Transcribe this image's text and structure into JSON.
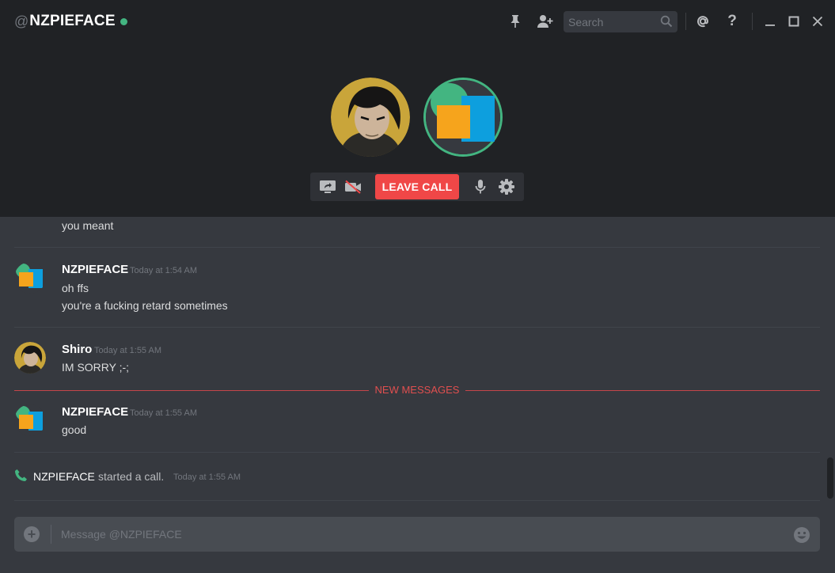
{
  "header": {
    "at_symbol": "@",
    "channel_name": "NZPIEFACE",
    "status_color": "#43b581",
    "icons": [
      "pin-icon",
      "add-friend-icon",
      "search-icon",
      "mention-icon",
      "help-icon",
      "minimize-icon",
      "maximize-icon",
      "close-icon"
    ],
    "search_placeholder": "Search",
    "help_label": "?"
  },
  "call": {
    "leave_label": "LEAVE CALL",
    "leave_color": "#f04747",
    "speaking_color": "#43b581",
    "icons": [
      "screen-share-icon",
      "video-off-icon",
      "microphone-icon",
      "settings-icon"
    ]
  },
  "messages": {
    "partial_line": "you meant",
    "groups": [
      {
        "author": "NZPIEFACE",
        "timestamp": "Today at 1:54 AM",
        "lines": [
          "oh ffs",
          "you're a fucking retard sometimes"
        ]
      },
      {
        "author": "Shiro",
        "timestamp": "Today at 1:55 AM",
        "lines": [
          "IM SORRY ;-;"
        ]
      },
      {
        "author": "NZPIEFACE",
        "timestamp": "Today at 1:55 AM",
        "lines": [
          "good"
        ]
      }
    ],
    "new_messages_label": "NEW MESSAGES",
    "new_messages_color": "#f04747",
    "system_call": {
      "user": "NZPIEFACE",
      "text": "started a call.",
      "timestamp": "Today at 1:55 AM"
    }
  },
  "composer": {
    "placeholder": "Message @NZPIEFACE",
    "plus_label": "+"
  }
}
